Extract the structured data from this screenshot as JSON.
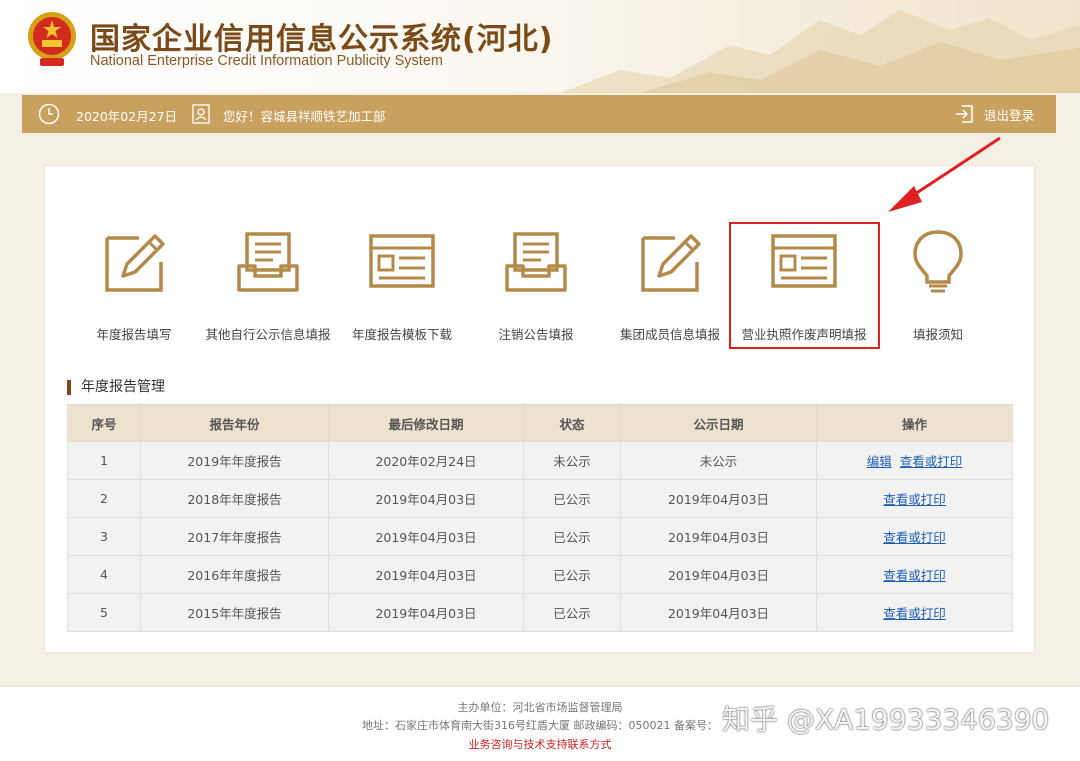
{
  "header": {
    "title_cn": "国家企业信用信息公示系统(河北)",
    "title_en": "National Enterprise Credit Information Publicity System"
  },
  "userbar": {
    "date": "2020年02月27日",
    "greeting": "您好！容城县祥顺铁艺加工部",
    "logout_label": "退出登录"
  },
  "functions": [
    {
      "label": "年度报告填写",
      "icon": "edit-icon"
    },
    {
      "label": "其他自行公示信息填报",
      "icon": "inbox-icon"
    },
    {
      "label": "年度报告模板下载",
      "icon": "template-icon"
    },
    {
      "label": "注销公告填报",
      "icon": "inbox-icon"
    },
    {
      "label": "集团成员信息填报",
      "icon": "edit-icon"
    },
    {
      "label": "营业执照作废声明填报",
      "icon": "template-icon"
    },
    {
      "label": "填报须知",
      "icon": "lightbulb-icon"
    }
  ],
  "section_title": "年度报告管理",
  "table": {
    "headers": [
      "序号",
      "报告年份",
      "最后修改日期",
      "状态",
      "公示日期",
      "操作"
    ],
    "rows": [
      {
        "no": "1",
        "year": "2019年年度报告",
        "modified": "2020年02月24日",
        "status": "未公示",
        "publish": "未公示",
        "actions": [
          "编辑",
          "查看或打印"
        ]
      },
      {
        "no": "2",
        "year": "2018年年度报告",
        "modified": "2019年04月03日",
        "status": "已公示",
        "publish": "2019年04月03日",
        "actions": [
          "查看或打印"
        ]
      },
      {
        "no": "3",
        "year": "2017年年度报告",
        "modified": "2019年04月03日",
        "status": "已公示",
        "publish": "2019年04月03日",
        "actions": [
          "查看或打印"
        ]
      },
      {
        "no": "4",
        "year": "2016年年度报告",
        "modified": "2019年04月03日",
        "status": "已公示",
        "publish": "2019年04月03日",
        "actions": [
          "查看或打印"
        ]
      },
      {
        "no": "5",
        "year": "2015年年度报告",
        "modified": "2019年04月03日",
        "status": "已公示",
        "publish": "2019年04月03日",
        "actions": [
          "查看或打印"
        ]
      }
    ]
  },
  "footer": {
    "sponsor": "主办单位：河北省市场监督管理局",
    "address": "地址：石家庄市体育南大街316号红盾大厦 邮政编码：050021 备案号：",
    "support": "业务咨询与技术支持联系方式"
  },
  "watermark": "知乎 @XA19933346390",
  "colors": {
    "brand_brown": "#7a4a18",
    "gold_bar": "#c8a15f",
    "icon_gold": "#b38a4a",
    "highlight_red": "#e02020",
    "link_blue": "#1d5fb7"
  }
}
